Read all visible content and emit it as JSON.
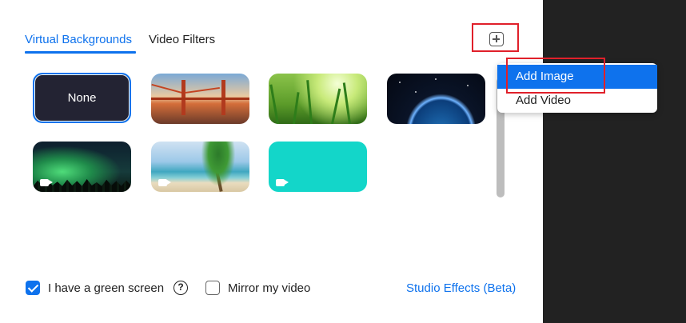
{
  "tabs": {
    "virtual_backgrounds": "Virtual Backgrounds",
    "video_filters": "Video Filters"
  },
  "tiles": {
    "none_label": "None"
  },
  "menu": {
    "add_image": "Add Image",
    "add_video": "Add Video"
  },
  "options": {
    "green_screen_label": "I have a green screen",
    "green_screen_checked": true,
    "help_glyph": "?",
    "mirror_label": "Mirror my video",
    "mirror_checked": false,
    "studio_effects": "Studio Effects (Beta)"
  },
  "icons": {
    "add": "plus-square-icon",
    "video": "video-camera-icon",
    "help": "question-circle-icon"
  },
  "colors": {
    "accent": "#0e72ed",
    "highlight_box": "#e0202a",
    "dark_panel": "#222222"
  }
}
